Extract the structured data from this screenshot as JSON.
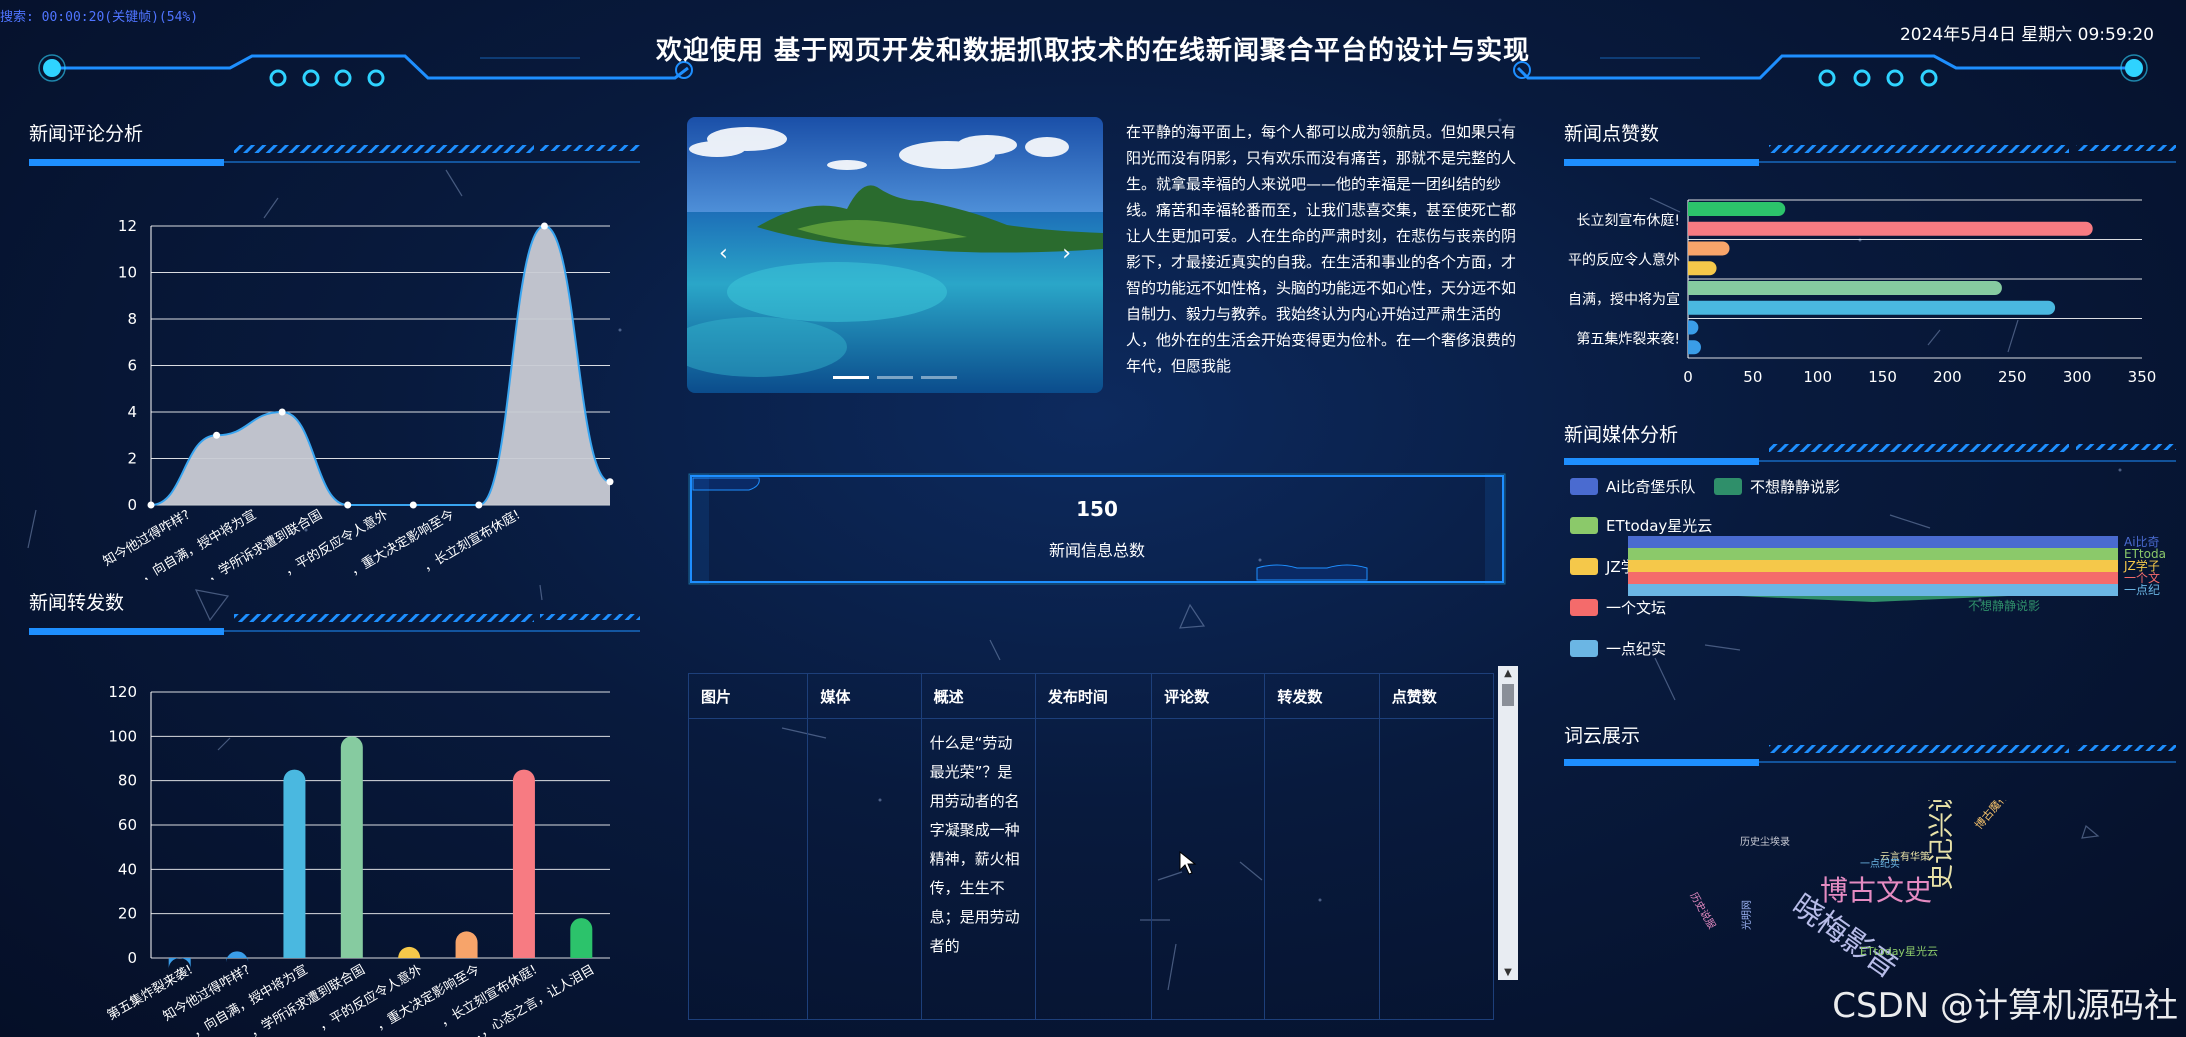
{
  "top_recording": "搜索: 00:00:20(关键帧)(54%)",
  "header": {
    "title": "欢迎使用 基于网页开发和数据抓取技术的在线新闻聚合平台的设计与实现",
    "datetime": "2024年5月4日 星期六 09:59:20"
  },
  "panels": {
    "comment": "新闻评论分析",
    "forward": "新闻转发数",
    "like": "新闻点赞数",
    "media": "新闻媒体分析",
    "wordcloud": "词云展示"
  },
  "carousel": {
    "prev": "‹",
    "next": "›",
    "slide_count": 3,
    "active": 0
  },
  "intro_text": "在平静的海平面上，每个人都可以成为领航员。但如果只有阳光而没有阴影，只有欢乐而没有痛苦，那就不是完整的人生。就拿最幸福的人来说吧——他的幸福是一团纠结的纱线。痛苦和幸福轮番而至，让我们悲喜交集，甚至使死亡都让人生更加可爱。人在生命的严肃时刻，在悲伤与丧亲的阴影下，才最接近真实的自我。在生活和事业的各个方面，才智的功能远不如性格，头脑的功能远不如心性，天分远不如自制力、毅力与教养。我始终认为内心开始过严肃生活的人，他外在的生活会开始变得更为俭朴。在一个奢侈浪费的年代，但愿我能",
  "total": {
    "number": "150",
    "label": "新闻信息总数"
  },
  "table": {
    "headers": [
      "图片",
      "媒体",
      "概述",
      "发布时间",
      "评论数",
      "转发数",
      "点赞数"
    ],
    "rows": [
      {
        "summary": "什么是“劳动最光荣”？是用劳动者的名字凝聚成一种精神，薪火相传，生生不息；是用劳动者的"
      }
    ],
    "scroll_up": "▲",
    "scroll_down": "▼"
  },
  "watermark": "CSDN @计算机源码社",
  "chart_data": [
    {
      "type": "area",
      "title": "新闻评论分析",
      "x_tick_labels": [
        "知今他过得咋样?",
        "，向自满，授中将为宣",
        "，学所诉求遭到联合国",
        "，平的反应令人意外",
        "，重大决定影响至今",
        "，长立刻宣布休庭!"
      ],
      "values": [
        0,
        3,
        4,
        0,
        0,
        0,
        12,
        1
      ],
      "ylim": [
        0,
        12
      ],
      "yticks": [
        0,
        2,
        4,
        6,
        8,
        10,
        12
      ],
      "fill_color": "#c9cbd4",
      "line_color": "#39a5f0"
    },
    {
      "type": "bar",
      "title": "新闻转发数",
      "categories": [
        "第五集炸裂来袭!",
        "知今他过得咋样?",
        "，向自满，授中将为宣",
        "，学所诉求遭到联合国",
        "，平的反应令人意外",
        "，重大决定影响至今",
        "，长立刻宣布休庭!",
        "，，心态之言，让人泪目"
      ],
      "values": [
        0,
        3,
        85,
        100,
        5,
        12,
        85,
        18
      ],
      "colors": [
        "#3a9de8",
        "#3a9de8",
        "#4ab8e0",
        "#86cba0",
        "#f5c84a",
        "#f7a46a",
        "#f77b82",
        "#2cc36b"
      ],
      "ylim": [
        0,
        120
      ],
      "yticks": [
        0,
        20,
        40,
        60,
        80,
        100,
        120
      ]
    },
    {
      "type": "bar",
      "orientation": "horizontal",
      "title": "新闻点赞数",
      "category_labels": [
        "长立刻宣布休庭!",
        "平的反应令人意外",
        "自满，授中将为宣",
        "第五集炸裂来袭!"
      ],
      "values": [
        75,
        312,
        32,
        22,
        242,
        283,
        8,
        10
      ],
      "colors": [
        "#2cc36b",
        "#f77b82",
        "#f7a46a",
        "#f5c84a",
        "#86cba0",
        "#4ab8e0",
        "#3a9de8",
        "#3a9de8"
      ],
      "xlim": [
        0,
        350
      ],
      "xticks": [
        0,
        50,
        100,
        150,
        200,
        250,
        300,
        350
      ]
    },
    {
      "type": "funnel",
      "title": "新闻媒体分析",
      "legend": [
        {
          "name": "Ai比奇堡乐队",
          "color": "#4a6bd0"
        },
        {
          "name": "不想静静说影",
          "color": "#2f8f6a"
        },
        {
          "name": "ETtoday星光云",
          "color": "#8bc96a"
        },
        {
          "name": "JZ学子",
          "color": "#f5c84a"
        },
        {
          "name": "一个文坛",
          "color": "#f46b6b"
        },
        {
          "name": "一点纪实",
          "color": "#6bb6e4"
        }
      ],
      "right_labels": [
        "Ai比奇",
        "ETtoda",
        "JZ学子",
        "一个文",
        "一点纪"
      ],
      "bottom_label": "不想静静说影"
    }
  ],
  "wordcloud": [
    {
      "text": "晓梅影音",
      "color": "#b7bce8",
      "size": 30
    },
    {
      "text": "博古文史",
      "color": "#e58bc2",
      "size": 28
    },
    {
      "text": "史记兴说",
      "color": "#e8e2a8",
      "size": 26
    },
    {
      "text": "博古魔行",
      "color": "#f3c06a",
      "size": 11
    },
    {
      "text": "历史尘埃录",
      "color": "#c9cbd4",
      "size": 10
    },
    {
      "text": "云言有华策",
      "color": "#e8e2a8",
      "size": 10
    },
    {
      "text": "ETtoday星光云",
      "color": "#8bc96a",
      "size": 11
    },
    {
      "text": "光明网",
      "color": "#9db4f5",
      "size": 10
    },
    {
      "text": "一点纪实",
      "color": "#6bb6e4",
      "size": 10
    },
    {
      "text": "历史说服",
      "color": "#e58bc2",
      "size": 10
    }
  ]
}
